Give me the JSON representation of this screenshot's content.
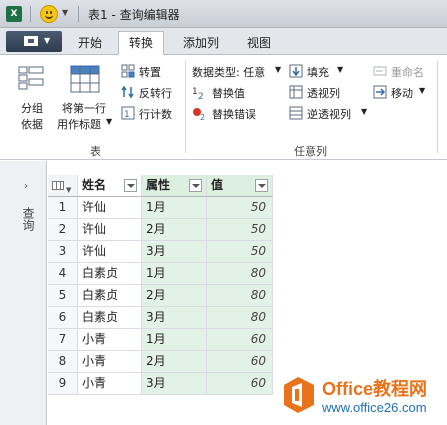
{
  "window": {
    "title": "表1 - 查询编辑器"
  },
  "tabs": [
    {
      "label": "开始"
    },
    {
      "label": "转换"
    },
    {
      "label": "添加列"
    },
    {
      "label": "视图"
    }
  ],
  "active_tab": "转换",
  "ribbon": {
    "group_table": {
      "label": "表",
      "group_by_line1": "分组",
      "group_by_line2": "依据",
      "use_first_row_line1": "将第一行",
      "use_first_row_line2": "用作标题",
      "transpose": "转置",
      "reverse_rows": "反转行",
      "count_rows": "行计数"
    },
    "group_any_column": {
      "label": "任意列",
      "data_type": "数据类型: 任意",
      "replace_values": "替换值",
      "replace_errors": "替换错误",
      "fill": "填充",
      "pivot": "透视列",
      "unpivot": "逆透视列",
      "rename": "重命名",
      "move": "移动"
    }
  },
  "left_panel": {
    "label": "查询"
  },
  "table": {
    "columns": [
      "姓名",
      "属性",
      "值"
    ],
    "rows": [
      {
        "n": "1",
        "name": "许仙",
        "attr": "1月",
        "val": "50"
      },
      {
        "n": "2",
        "name": "许仙",
        "attr": "2月",
        "val": "50"
      },
      {
        "n": "3",
        "name": "许仙",
        "attr": "3月",
        "val": "50"
      },
      {
        "n": "4",
        "name": "白素贞",
        "attr": "1月",
        "val": "80"
      },
      {
        "n": "5",
        "name": "白素贞",
        "attr": "2月",
        "val": "80"
      },
      {
        "n": "6",
        "name": "白素贞",
        "attr": "3月",
        "val": "80"
      },
      {
        "n": "7",
        "name": "小青",
        "attr": "1月",
        "val": "60"
      },
      {
        "n": "8",
        "name": "小青",
        "attr": "2月",
        "val": "60"
      },
      {
        "n": "9",
        "name": "小青",
        "attr": "3月",
        "val": "60"
      }
    ]
  },
  "watermark": {
    "title": "Office教程网",
    "url": "www.office26.com"
  },
  "colors": {
    "accent_green": "#e3f2e7",
    "watermark_orange": "#e8731a",
    "watermark_blue": "#1f6fb5"
  }
}
